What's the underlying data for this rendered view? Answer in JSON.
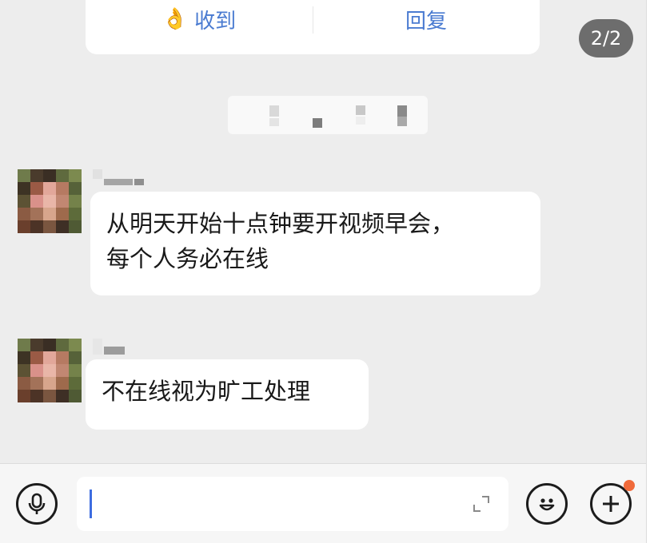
{
  "notification_card": {
    "received_label": "收到",
    "reply_label": "回复",
    "ok_emoji": "👌"
  },
  "image_pager": {
    "label": "2/2"
  },
  "messages": [
    {
      "lines": [
        "从明天开始十点钟要开视频早会，",
        "每个人务必在线"
      ]
    },
    {
      "lines": [
        "不在线视为旷工处理"
      ]
    }
  ],
  "icons": {
    "voice": "microphone-icon",
    "expand": "expand-icon",
    "emoji": "smiley-icon",
    "more": "plus-icon"
  },
  "colors": {
    "accent_blue": "#4a7bd1",
    "badge_gray": "#6d6d6d",
    "notification_dot": "#f06a3a",
    "caret": "#3d6de0"
  }
}
